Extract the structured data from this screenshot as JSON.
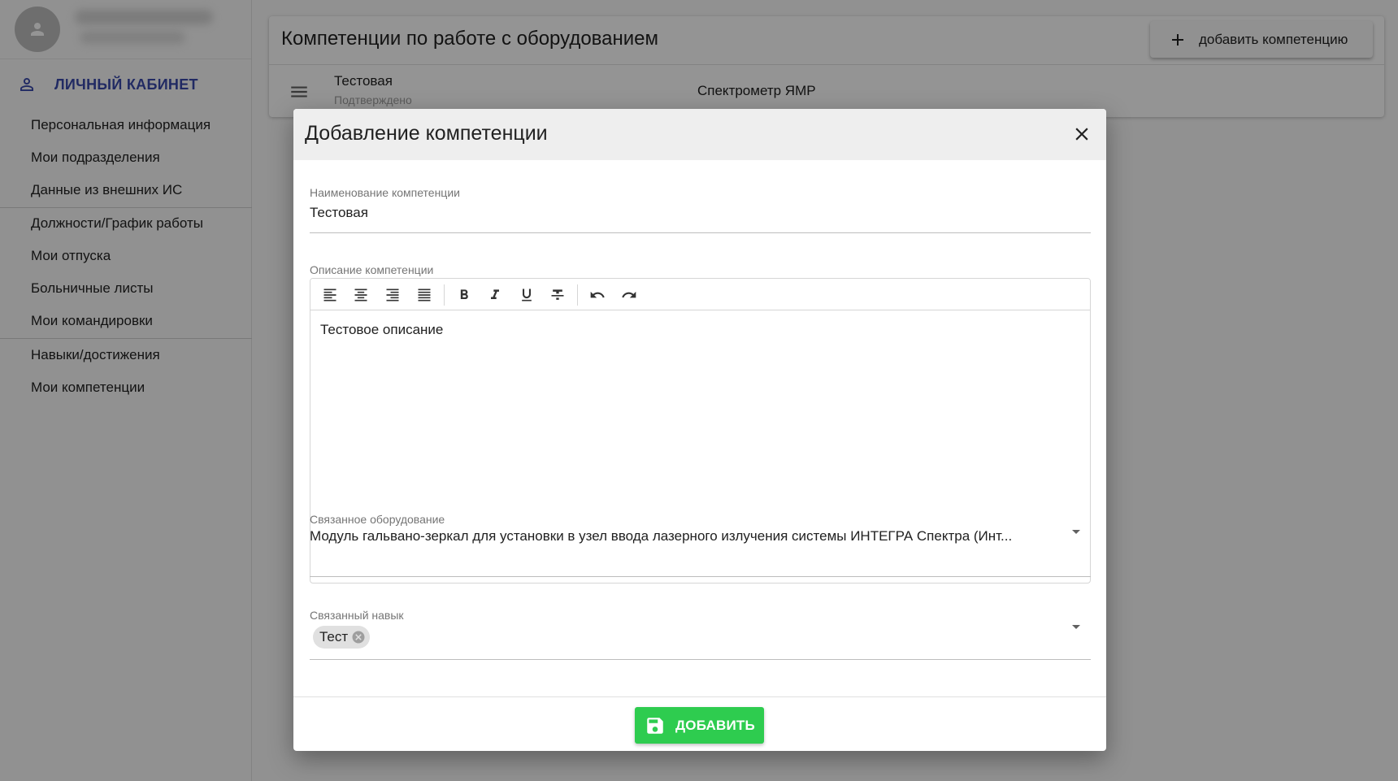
{
  "sidebar": {
    "section_title": "ЛИЧНЫЙ КАБИНЕТ",
    "items": [
      {
        "label": "Персональная информация"
      },
      {
        "label": "Мои подразделения"
      },
      {
        "label": "Данные из внешних ИС"
      },
      {
        "label": "Должности/График работы"
      },
      {
        "label": "Мои отпуска"
      },
      {
        "label": "Больничные листы"
      },
      {
        "label": "Мои командировки"
      },
      {
        "label": "Навыки/достижения"
      },
      {
        "label": "Мои компетенции"
      }
    ]
  },
  "main": {
    "title": "Компетенции по работе с оборудованием",
    "add_button": "добавить компетенцию",
    "rows": [
      {
        "name": "Тестовая",
        "status": "Подтверждено",
        "equipment": "Спектрометр ЯМР"
      }
    ]
  },
  "dialog": {
    "title": "Добавление компетенции",
    "name_field": {
      "label": "Наименование компетенции",
      "value": "Тестовая"
    },
    "description_field": {
      "label": "Описание компетенции",
      "value": "Тестовое описание"
    },
    "equipment_field": {
      "label": "Связанное оборудование",
      "value": "Модуль гальвано-зеркал для установки в узел ввода лазерного излучения системы ИНТЕГРА Спектра (Инт..."
    },
    "skill_field": {
      "label": "Связанный навык",
      "chips": [
        "Тест"
      ]
    },
    "submit_button": "ДОБАВИТЬ"
  },
  "colors": {
    "accent": "#3949ab",
    "submit": "#2ecc4f",
    "overlay": "rgba(0,0,0,0.42)"
  }
}
